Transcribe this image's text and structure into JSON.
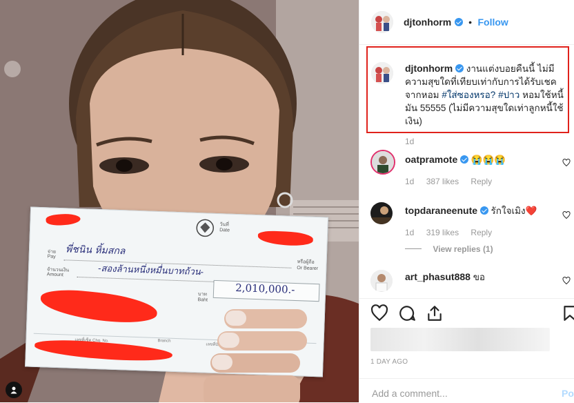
{
  "header": {
    "username": "djtonhorm",
    "separator": "•",
    "follow_label": "Follow"
  },
  "caption": {
    "username": "djtonhorm",
    "text_1": "งานแต่งบอยคืนนี้ ไม่มีความสุขใดที่เทียบเท่ากับการได้รับเชคจากหอม ",
    "hashtag_1": "#ใส่ซองหรอ?",
    "hashtag_2": "#ปาว",
    "text_2": " หอมใช้หนี้มัน 55555 (ไม่มีความสุขใดเท่าลูกหนี้ใช้เงิน)",
    "time": "1d"
  },
  "comments": [
    {
      "username": "oatpramote",
      "text": "😭😭😭",
      "time": "1d",
      "likes": "387 likes",
      "reply": "Reply"
    },
    {
      "username": "topdaraneenute",
      "text": "รักใจเมิง❤️",
      "time": "1d",
      "likes": "319 likes",
      "reply": "Reply",
      "view_replies": "View replies (1)"
    },
    {
      "username": "art_phasut888",
      "text": "ขอ"
    }
  ],
  "footer": {
    "time_ago": "1 DAY AGO",
    "comment_placeholder": "Add a comment...",
    "post_label": "Pos"
  },
  "cheque": {
    "pay_label_th": "จ่าย",
    "pay_label_en": "Pay",
    "payee": "พี่ชนิน  หิ้มสกล",
    "amount_label_th": "จำนวนเงิน",
    "amount_label_en": "Amount",
    "amount_words": "-สองล้านหนึ่งหมื่นบาทถ้วน-",
    "date_label_th": "วันที่",
    "date_label_en": "Date",
    "baht_label_th": "บาท",
    "baht_label_en": "Baht",
    "amount_figure": "2,010,000.-",
    "bearer": "หรือผู้ถือ\nOr Bearer",
    "cheque_no": "เลขที่เช็ค Chq. No.",
    "branch": "Branch",
    "account_no": "เลขที่บัญชี Account No."
  },
  "colors": {
    "accent": "#3897f0",
    "highlight_border": "#e0211b",
    "redaction": "#ff2a1a"
  }
}
